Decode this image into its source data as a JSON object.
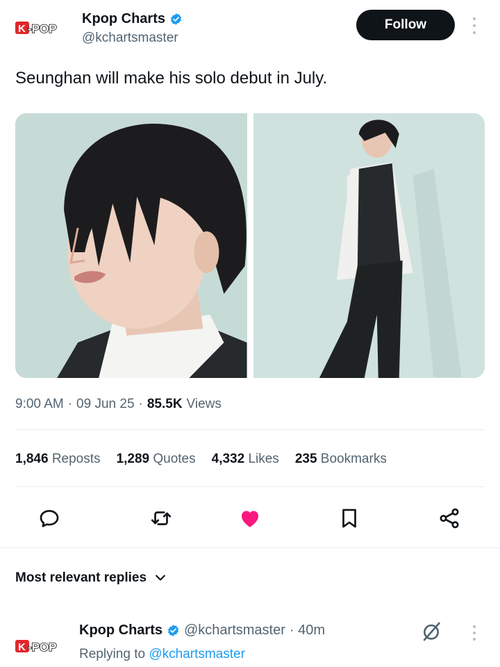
{
  "author": {
    "logo_text": "K-POP",
    "name": "Kpop Charts",
    "handle": "@kchartsmaster",
    "follow_label": "Follow",
    "verified_color": "#1d9bf0"
  },
  "tweet": {
    "text": "Seunghan will make his solo debut in July.",
    "time": "9:00 AM",
    "date": "09 Jun 25",
    "views_count": "85.5K",
    "views_label": "Views",
    "separator": "·"
  },
  "stats": [
    {
      "num": "1,846",
      "label": "Reposts"
    },
    {
      "num": "1,289",
      "label": "Quotes"
    },
    {
      "num": "4,332",
      "label": "Likes"
    },
    {
      "num": "235",
      "label": "Bookmarks"
    }
  ],
  "actions": {
    "reply": "reply-icon",
    "repost": "repost-icon",
    "like": "heart-icon",
    "bookmark": "bookmark-icon",
    "share": "share-icon",
    "like_color": "#f91880"
  },
  "replies": {
    "sort_label": "Most relevant replies",
    "first": {
      "name": "Kpop Charts",
      "handle": "@kchartsmaster",
      "time": "· 40m",
      "replying_prefix": "Replying to",
      "replying_handle": "@kchartsmaster"
    }
  }
}
